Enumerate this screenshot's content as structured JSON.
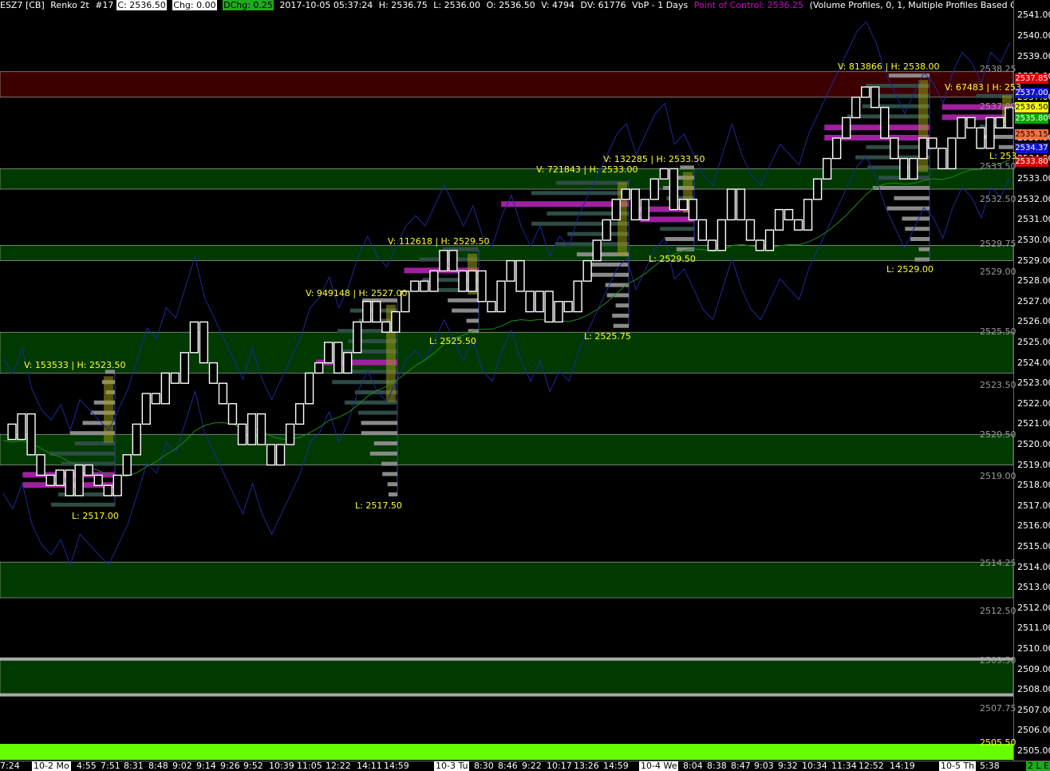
{
  "header": {
    "symbol": "ESZ7 [CB]",
    "bar_type": "Renko 2t",
    "chart_number": "#17",
    "close": "C: 2536.50",
    "change": "Chg: 0.00",
    "dchange": "DChg: 0.25",
    "datetime": "2017-10-05 05:37:24",
    "high": "H: 2536.75",
    "low": "L: 2536.00",
    "open": "O: 2536.50",
    "volume": "V: 4794",
    "dv": "DV: 61776",
    "study": "VbP - 1 Days",
    "poc": "Point of Control: 2536.25",
    "study_params": "(Volume Profiles, 0, 1, Multiple Profiles Based On Fixed Time, No, Days, 1,"
  },
  "colors": {
    "background": "#000000",
    "resistance_zone": "#3d0000",
    "support_zone": "#003a00",
    "poc_bar": "#a020a0",
    "value_area_bar": "#2f4c46",
    "profile_bar_outside": "#8a8a8a",
    "volume_highlight": "#9a9a1a",
    "vwap_line": "#c01818",
    "bands_line": "#1a2a9a",
    "ma_line": "#1e8a1e",
    "bottom_bar": "#66ff00"
  },
  "price_axis": {
    "ticks": [
      "2541.00",
      "2540.00",
      "2539.00",
      "2538.00",
      "2537.00",
      "2536.00",
      "2535.00",
      "2534.00",
      "2533.00",
      "2532.00",
      "2531.00",
      "2530.00",
      "2529.00",
      "2528.00",
      "2527.00",
      "2526.00",
      "2525.00",
      "2524.00",
      "2523.00",
      "2522.00",
      "2521.00",
      "2520.00",
      "2519.00",
      "2518.00",
      "2517.00",
      "2516.00",
      "2515.00",
      "2514.00",
      "2513.00",
      "2512.00",
      "2511.00",
      "2510.00",
      "2509.00",
      "2508.00",
      "2507.00",
      "2506.00",
      "2505.00"
    ],
    "price_labels": [
      {
        "text": "2537.85",
        "bg": "#e00000",
        "fg": "#ffffff"
      },
      {
        "text": "2537.00",
        "bg": "#1010d0",
        "fg": "#ffffff"
      },
      {
        "text": "2536.50",
        "bg": "#ffff00",
        "fg": "#000000"
      },
      {
        "text": "2535.80",
        "bg": "#00aa00",
        "fg": "#ffffff"
      },
      {
        "text": "2535.15",
        "bg": "#ff7040",
        "fg": "#000000"
      },
      {
        "text": "2534.37",
        "bg": "#1010d0",
        "fg": "#ffffff"
      },
      {
        "text": "2533.80",
        "bg": "#e00000",
        "fg": "#ffffff"
      }
    ]
  },
  "zone_labels": [
    "2538.25",
    "2537.00",
    "2533.50",
    "2532.50",
    "2529.75",
    "2529.00",
    "2525.50",
    "2523.50",
    "2520.50",
    "2519.00",
    "2514.25",
    "2512.50",
    "2509.50",
    "2507.75",
    "2505.50"
  ],
  "profile_labels": {
    "p1_high": "V: 153533 | H: 2523.50",
    "p1_low": "L: 2517.00",
    "p2_high": "V: 949148 | H: 2527.00",
    "p2_low": "L: 2517.50",
    "p3_high": "V: 112618 | H: 2529.50",
    "p3_low": "L: 2525.50",
    "p4_high": "V: 721843 | H: 2533.00",
    "p4_low": "L: 2525.75",
    "p5_high": "V: 132285 | H: 2533.50",
    "p5_low": "L: 2529.50",
    "p6_high": "V: 813866 | H: 2538.00",
    "p6_low": "L: 2529.00",
    "p7_high": "V: 67483 | H: 253",
    "p7_low": "L: 253"
  },
  "time_axis": [
    "7:24",
    "10-2 Mo",
    "4:55",
    "7:51",
    "8:31",
    "8:48",
    "9:02",
    "9:14",
    "9:26",
    "9:52",
    "10:39",
    "11:05",
    "12:22",
    "14:11",
    "14:59",
    "10-3 Tu",
    "8:30",
    "8:46",
    "9:22",
    "10:17",
    "13:26",
    "14:59",
    "10-4 We",
    "8:04",
    "8:38",
    "8:47",
    "9:03",
    "9:32",
    "10:34",
    "11:34",
    "12:52",
    "14:19",
    "10-5 Th",
    "5:38"
  ],
  "status_badge": "2 L E",
  "chart_data": {
    "type": "renko",
    "instrument": "ESZ7",
    "brick_size_ticks": 2,
    "tick_size": 0.25,
    "ylim": [
      2505,
      2541.5
    ],
    "resistance_zones": [
      [
        2537.0,
        2538.25
      ]
    ],
    "support_zones": [
      [
        2532.5,
        2533.5
      ],
      [
        2529.0,
        2529.75
      ],
      [
        2523.5,
        2525.5
      ],
      [
        2519.0,
        2520.5
      ],
      [
        2512.5,
        2514.25
      ],
      [
        2507.75,
        2509.5
      ]
    ],
    "volume_profiles": [
      {
        "session": "10-2",
        "volume": 153533,
        "high": 2523.5,
        "low": 2517.0,
        "poc": 2518.25
      },
      {
        "session": "10-2",
        "volume": 949148,
        "high": 2527.0,
        "low": 2517.5,
        "poc": 2524.0
      },
      {
        "session": "10-3",
        "volume": 112618,
        "high": 2529.5,
        "low": 2525.5,
        "poc": 2528.5
      },
      {
        "session": "10-3",
        "volume": 721843,
        "high": 2533.0,
        "low": 2525.75,
        "poc": 2531.75
      },
      {
        "session": "10-4",
        "volume": 132285,
        "high": 2533.5,
        "low": 2529.5,
        "poc": 2531.25
      },
      {
        "session": "10-4",
        "volume": 813866,
        "high": 2538.0,
        "low": 2529.0,
        "poc": 2535.25
      },
      {
        "session": "10-5",
        "volume": 67483,
        "high": null,
        "low": null,
        "poc": 2536.25
      }
    ],
    "price_path": [
      2521,
      2520.25,
      2521.5,
      2519.5,
      2518.5,
      2518,
      2518.75,
      2517.5,
      2519,
      2518.5,
      2518,
      2517.5,
      2518.5,
      2519.5,
      2521,
      2522.5,
      2522,
      2523.5,
      2523,
      2524.5,
      2526,
      2524,
      2523,
      2522,
      2521,
      2520,
      2521.5,
      2520,
      2519,
      2520,
      2521,
      2522,
      2523.5,
      2524,
      2525,
      2523.5,
      2524.5,
      2526,
      2527,
      2526,
      2525.5,
      2526.5,
      2527.5,
      2528,
      2527.5,
      2528.5,
      2529.5,
      2528.5,
      2527.5,
      2528.5,
      2527,
      2526.5,
      2528,
      2529,
      2527.5,
      2526.5,
      2527.5,
      2526,
      2527,
      2526.5,
      2528,
      2529,
      2530,
      2531,
      2532,
      2532.5,
      2531,
      2532,
      2533,
      2533.5,
      2531.5,
      2532,
      2531,
      2530,
      2529.5,
      2531,
      2532.5,
      2531,
      2530,
      2529.5,
      2530.5,
      2531.5,
      2531,
      2530.5,
      2532,
      2533,
      2534,
      2535,
      2536,
      2537,
      2537.5,
      2536.5,
      2535,
      2534,
      2533,
      2534,
      2535,
      2534.5,
      2533.5,
      2535,
      2536,
      2535.5,
      2534.5,
      2536,
      2535.5,
      2536.5
    ]
  }
}
